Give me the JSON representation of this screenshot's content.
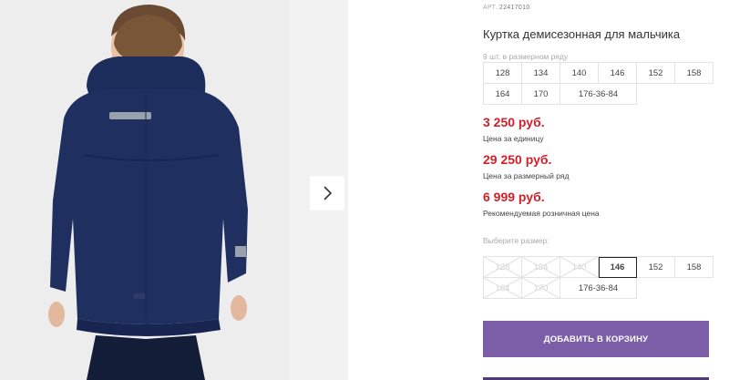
{
  "gallery": {
    "main_image_alt": "Куртка демисезонная для мальчика",
    "next_icon": "chevron-right-icon"
  },
  "product": {
    "sku_label": "АРТ.",
    "sku_value": "22417010",
    "title": "Куртка демисезонная для мальчика",
    "size_row_note": "9 шт. в размерном ряду",
    "size_row": [
      "128",
      "134",
      "140",
      "146",
      "152",
      "158",
      "164",
      "170",
      "176-36-84"
    ]
  },
  "prices": {
    "unit_price": "3 250 руб.",
    "unit_label": "Цена за единицу",
    "row_price": "29 250 руб.",
    "row_label": "Цена за размерный ряд",
    "retail_price": "6 999 руб.",
    "retail_label": "Рекомендуемая розничная цена"
  },
  "size_picker": {
    "label": "Выберите размер:",
    "options": [
      {
        "size": "128",
        "state": "unavailable"
      },
      {
        "size": "134",
        "state": "unavailable"
      },
      {
        "size": "140",
        "state": "unavailable"
      },
      {
        "size": "146",
        "state": "selected"
      },
      {
        "size": "152",
        "state": "available"
      },
      {
        "size": "158",
        "state": "available"
      },
      {
        "size": "164",
        "state": "unavailable"
      },
      {
        "size": "170",
        "state": "unavailable"
      },
      {
        "size": "176-36-84",
        "state": "available"
      }
    ]
  },
  "actions": {
    "add_to_cart": "ДОБАВИТЬ В КОРЗИНУ"
  },
  "colors": {
    "price_red": "#d0202a",
    "button_purple": "#7b5ea7",
    "jacket_navy": "#1f2f5f"
  }
}
